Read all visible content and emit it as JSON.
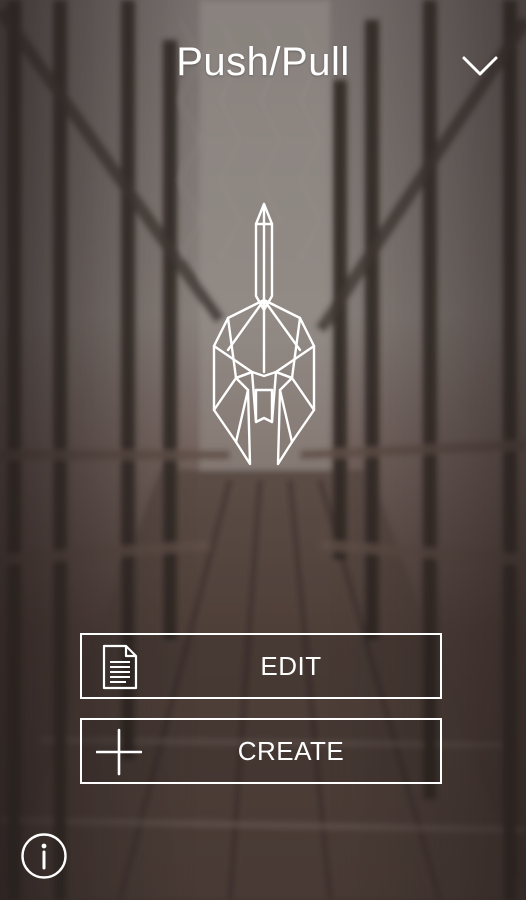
{
  "header": {
    "title": "Push/Pull",
    "dropdown_icon": "chevron-down-icon"
  },
  "logo": {
    "icon": "spartan-helmet-icon"
  },
  "actions": [
    {
      "label": "EDIT",
      "icon": "document-icon"
    },
    {
      "label": "CREATE",
      "icon": "plus-icon"
    }
  ],
  "footer": {
    "info_icon": "info-icon"
  },
  "colors": {
    "foreground": "#ffffff",
    "background_tint": "#6b5f5c"
  }
}
